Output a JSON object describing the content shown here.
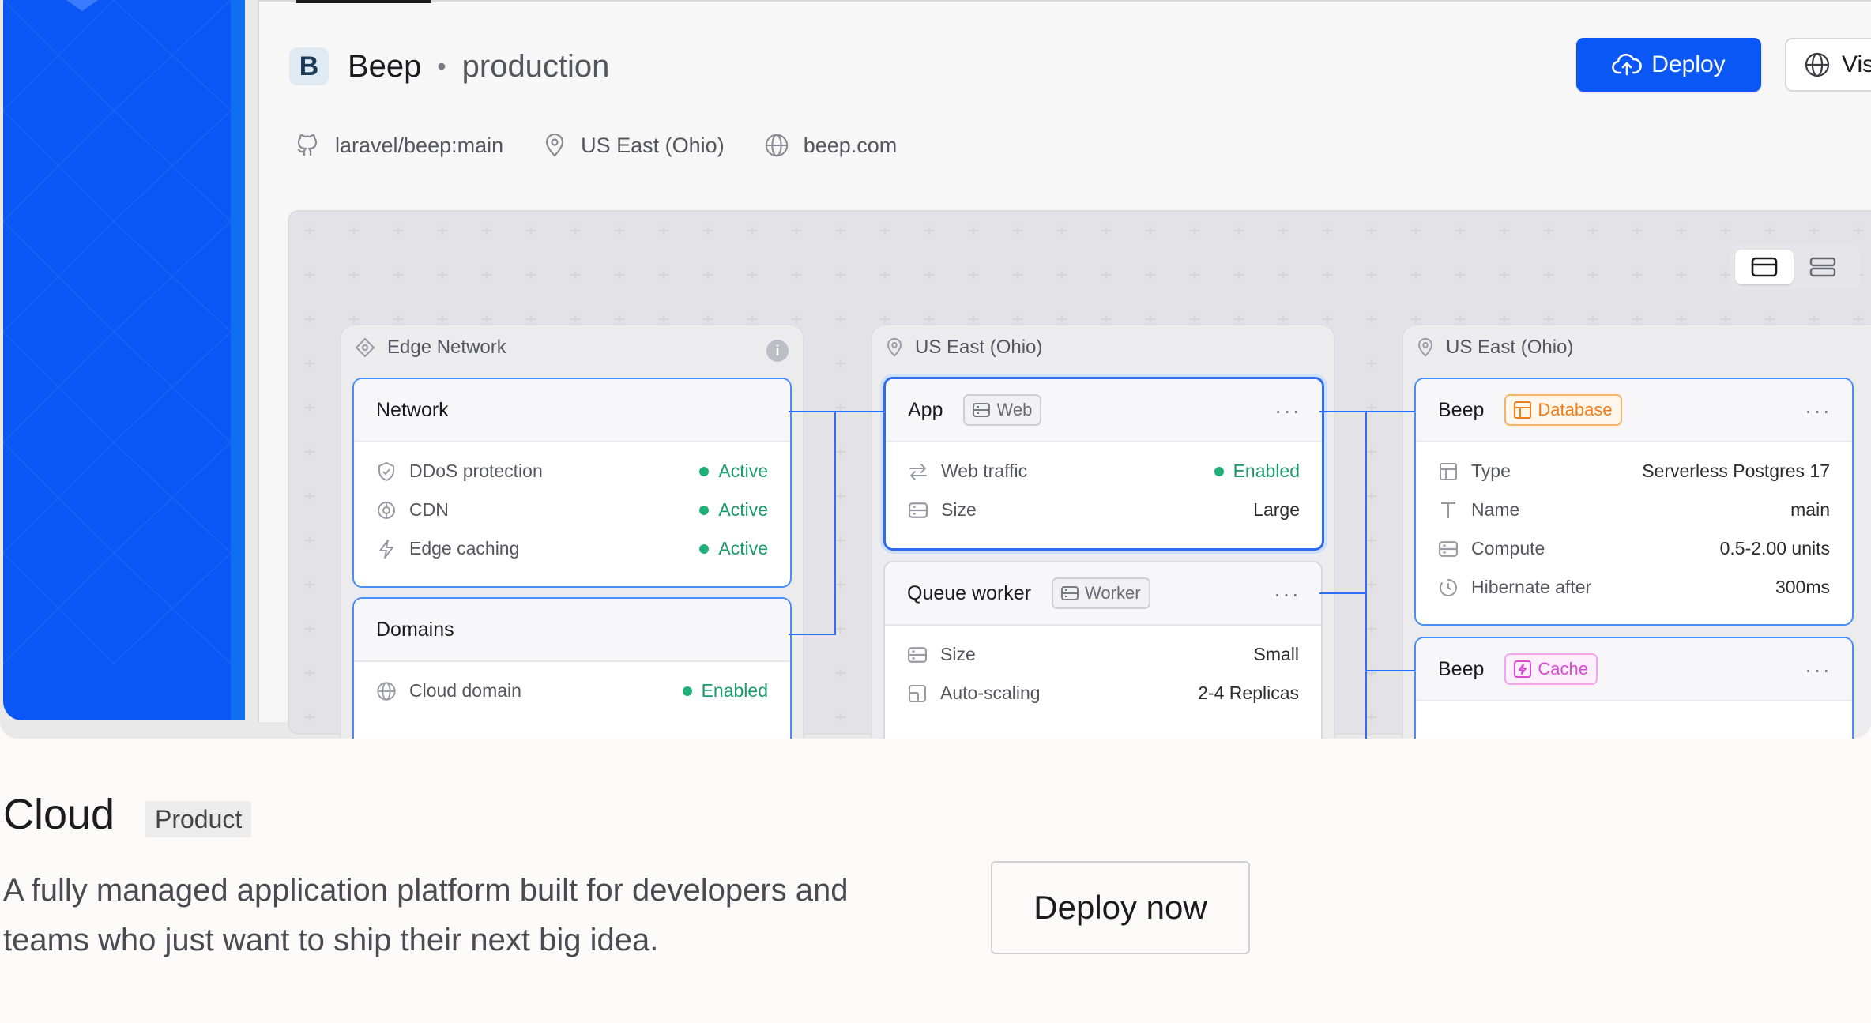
{
  "header": {
    "logo_letter": "B",
    "app_name": "Beep",
    "separator": "•",
    "environment": "production",
    "deploy_label": "Deploy",
    "visit_label": "Vis"
  },
  "meta": {
    "repo": "laravel/beep:main",
    "region": "US East (Ohio)",
    "domain": "beep.com"
  },
  "groups": {
    "edge": {
      "label": "Edge Network",
      "network": {
        "title": "Network",
        "rows": [
          {
            "label": "DDoS protection",
            "value": "Active",
            "icon": "shield-icon"
          },
          {
            "label": "CDN",
            "value": "Active",
            "icon": "cdn-icon"
          },
          {
            "label": "Edge caching",
            "value": "Active",
            "icon": "bolt-icon"
          }
        ]
      },
      "domains": {
        "title": "Domains",
        "rows": [
          {
            "label": "Cloud domain",
            "value": "Enabled",
            "icon": "globe-icon"
          }
        ]
      }
    },
    "compute": {
      "label": "US East (Ohio)",
      "app": {
        "title": "App",
        "tag": "Web",
        "rows": [
          {
            "label": "Web traffic",
            "value": "Enabled",
            "icon": "arrows-icon"
          },
          {
            "label": "Size",
            "value": "Large",
            "icon": "server-icon"
          }
        ]
      },
      "worker": {
        "title": "Queue worker",
        "tag": "Worker",
        "rows": [
          {
            "label": "Size",
            "value": "Small",
            "icon": "server-icon"
          },
          {
            "label": "Auto-scaling",
            "value": "2-4 Replicas",
            "icon": "scale-icon"
          }
        ]
      }
    },
    "data": {
      "label": "US East (Ohio)",
      "database": {
        "title": "Beep",
        "tag": "Database",
        "rows": [
          {
            "label": "Type",
            "value": "Serverless Postgres 17",
            "icon": "table-icon"
          },
          {
            "label": "Name",
            "value": "main",
            "icon": "text-icon"
          },
          {
            "label": "Compute",
            "value": "0.5-2.00 units",
            "icon": "server-icon"
          },
          {
            "label": "Hibernate after",
            "value": "300ms",
            "icon": "timer-icon"
          }
        ]
      },
      "cache": {
        "title": "Beep",
        "tag": "Cache"
      }
    }
  },
  "menu_dots": "···",
  "info_glyph": "i",
  "product": {
    "title": "Cloud",
    "badge": "Product",
    "description": "A fully managed application platform built for developers and teams who just want to ship their next big idea.",
    "cta": "Deploy now"
  },
  "colors": {
    "accent": "#0a57f5",
    "active_green": "#1fb07a",
    "database_orange": "#ef7d1a",
    "cache_pink": "#d94bd4"
  }
}
